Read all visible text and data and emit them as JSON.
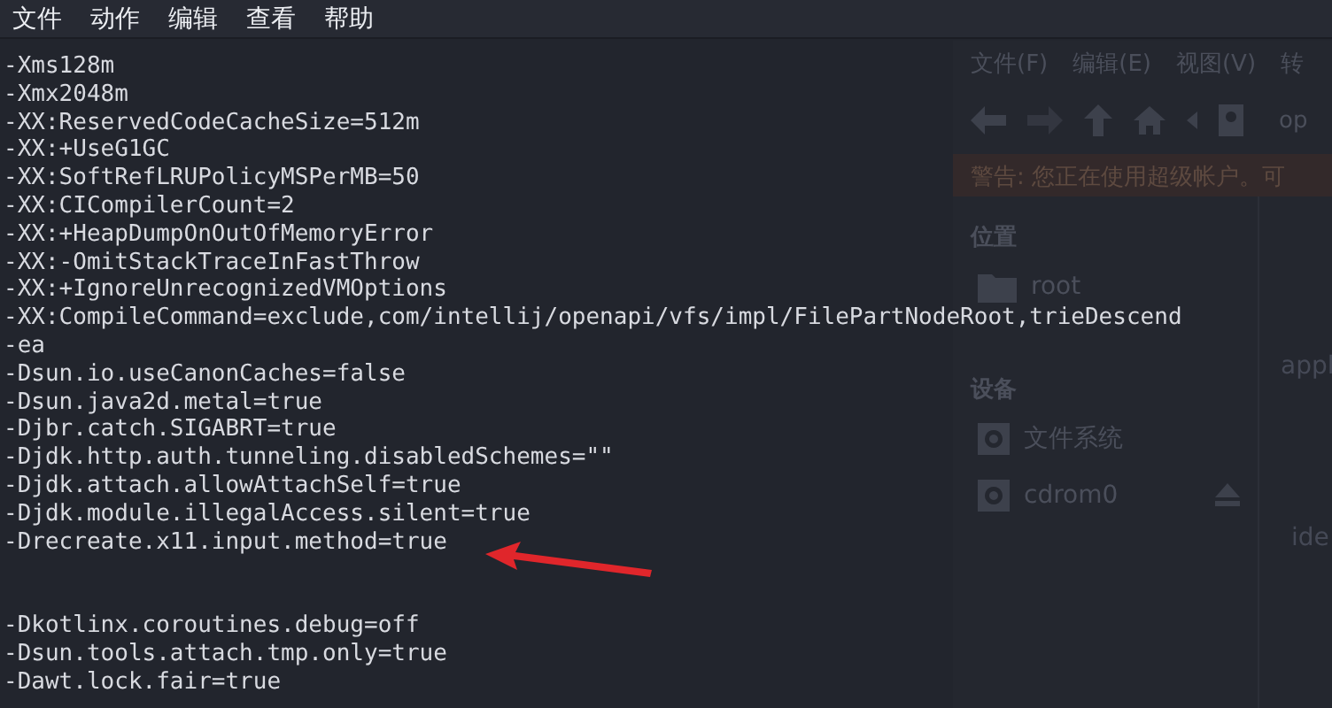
{
  "terminal": {
    "menu": [
      "文件",
      "动作",
      "编辑",
      "查看",
      "帮助"
    ],
    "blocks": [
      [
        "-Xms128m",
        "-Xmx2048m",
        "-XX:ReservedCodeCacheSize=512m",
        "-XX:+UseG1GC",
        "-XX:SoftRefLRUPolicyMSPerMB=50",
        "-XX:CICompilerCount=2",
        "-XX:+HeapDumpOnOutOfMemoryError",
        "-XX:-OmitStackTraceInFastThrow",
        "-XX:+IgnoreUnrecognizedVMOptions",
        "-XX:CompileCommand=exclude,com/intellij/openapi/vfs/impl/FilePartNodeRoot,trieDescend",
        "-ea",
        "-Dsun.io.useCanonCaches=false",
        "-Dsun.java2d.metal=true",
        "-Djbr.catch.SIGABRT=true",
        "-Djdk.http.auth.tunneling.disabledSchemes=\"\"",
        "-Djdk.attach.allowAttachSelf=true",
        "-Djdk.module.illegalAccess.silent=true",
        "-Drecreate.x11.input.method=true"
      ],
      [
        "-Dkotlinx.coroutines.debug=off",
        "-Dsun.tools.attach.tmp.only=true",
        "-Dawt.lock.fair=true"
      ]
    ]
  },
  "file_manager": {
    "menu": [
      "文件(F)",
      "编辑(E)",
      "视图(V)",
      "转"
    ],
    "path": "op",
    "warning": "警告: 您正在使用超级帐户。可",
    "sections": [
      {
        "title": "位置",
        "items": [
          {
            "label": "root",
            "kind": "folder",
            "eject": false
          }
        ]
      },
      {
        "title": "设备",
        "items": [
          {
            "label": "文件系统",
            "kind": "disk",
            "eject": false
          },
          {
            "label": "cdrom0",
            "kind": "disk",
            "eject": true
          }
        ]
      }
    ],
    "files": [
      "appl",
      "ide"
    ]
  }
}
